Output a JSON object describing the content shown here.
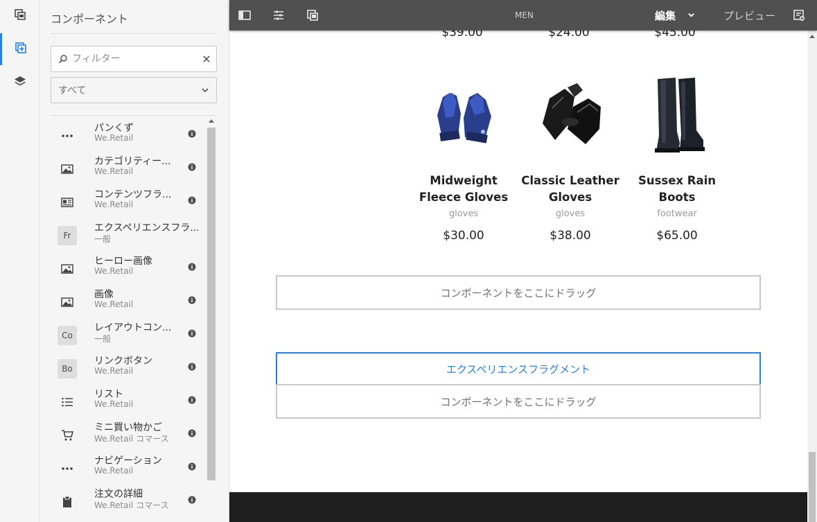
{
  "rail": {
    "items": [
      {
        "icon": "page-info-icon"
      },
      {
        "icon": "components-icon"
      },
      {
        "icon": "layers-icon"
      }
    ]
  },
  "panel": {
    "title": "コンポーネント",
    "filter_placeholder": "フィルター",
    "group_selected": "すべて",
    "components": [
      {
        "name": "パンくず",
        "group": "We.Retail",
        "icon": "more-horizontal-icon",
        "info": true
      },
      {
        "name": "カテゴリティー...",
        "group": "We.Retail",
        "icon": "image-icon",
        "info": true
      },
      {
        "name": "コンテンツフラ...",
        "group": "We.Retail",
        "icon": "content-fragment-icon",
        "info": true
      },
      {
        "name": "エクスペリエンスフラ...",
        "group": "一般",
        "abbr": "Fr",
        "info": false
      },
      {
        "name": "ヒーロー画像",
        "group": "We.Retail",
        "icon": "image-icon",
        "info": true
      },
      {
        "name": "画像",
        "group": "We.Retail",
        "icon": "image-icon",
        "info": true
      },
      {
        "name": "レイアウトコン...",
        "group": "一般",
        "abbr": "Co",
        "info": true
      },
      {
        "name": "リンクボタン",
        "group": "We.Retail",
        "abbr": "Bo",
        "info": true
      },
      {
        "name": "リスト",
        "group": "We.Retail",
        "icon": "list-icon",
        "info": true
      },
      {
        "name": "ミニ買い物かご",
        "group": "We.Retail コマース",
        "icon": "cart-icon",
        "info": true
      },
      {
        "name": "ナビゲーション",
        "group": "We.Retail",
        "icon": "more-horizontal-icon",
        "info": true
      },
      {
        "name": "注文の詳細",
        "group": "We.Retail コマース",
        "icon": "clipboard-icon",
        "info": true
      }
    ]
  },
  "topbar": {
    "page_title": "MEN",
    "mode": "編集",
    "preview": "プレビュー"
  },
  "content": {
    "top_prices": [
      "$39.00",
      "$24.00",
      "$45.00"
    ],
    "products": [
      {
        "name": "Midweight Fleece Gloves",
        "category": "gloves",
        "price": "$30.00",
        "image": "blue-gloves"
      },
      {
        "name": "Classic Leather Gloves",
        "category": "gloves",
        "price": "$38.00",
        "image": "black-leather-gloves"
      },
      {
        "name": "Sussex Rain Boots",
        "category": "footwear",
        "price": "$65.00",
        "image": "rain-boots"
      }
    ],
    "dropzone_label_1": "コンポーネントをここにドラッグ",
    "xf_label": "エクスペリエンスフラグメント",
    "dropzone_label_2": "コンポーネントをここにドラッグ"
  },
  "colors": {
    "accent": "#2680eb",
    "topbar": "#505050",
    "panel": "#f5f5f5",
    "footer": "#1e1e1e"
  }
}
